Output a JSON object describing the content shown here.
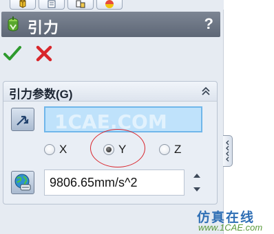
{
  "window": {
    "title": "引力",
    "help_label": "?"
  },
  "tabs": [
    {
      "icon": "feature-manager-icon"
    },
    {
      "icon": "property-manager-icon"
    },
    {
      "icon": "configuration-manager-icon"
    },
    {
      "icon": "display-manager-icon"
    }
  ],
  "confirm": {
    "ok_icon": "check-icon",
    "cancel_icon": "close-icon"
  },
  "gravity_group": {
    "title": "引力参数(G)",
    "selection_watermark": "1CAE.COM",
    "direction_options": [
      {
        "label": "X",
        "checked": false
      },
      {
        "label": "Y",
        "checked": true
      },
      {
        "label": "Z",
        "checked": false
      }
    ],
    "value": "9806.65mm/s^2"
  },
  "site_watermark": {
    "top": "仿真在线",
    "bottom": "www.1CAE.com"
  },
  "colors": {
    "titlebar": "#66707f",
    "selection_fill": "#bfe2fb",
    "highlight_ellipse": "#d9232a",
    "ok": "#2e9a2e",
    "cancel": "#d8262b"
  }
}
